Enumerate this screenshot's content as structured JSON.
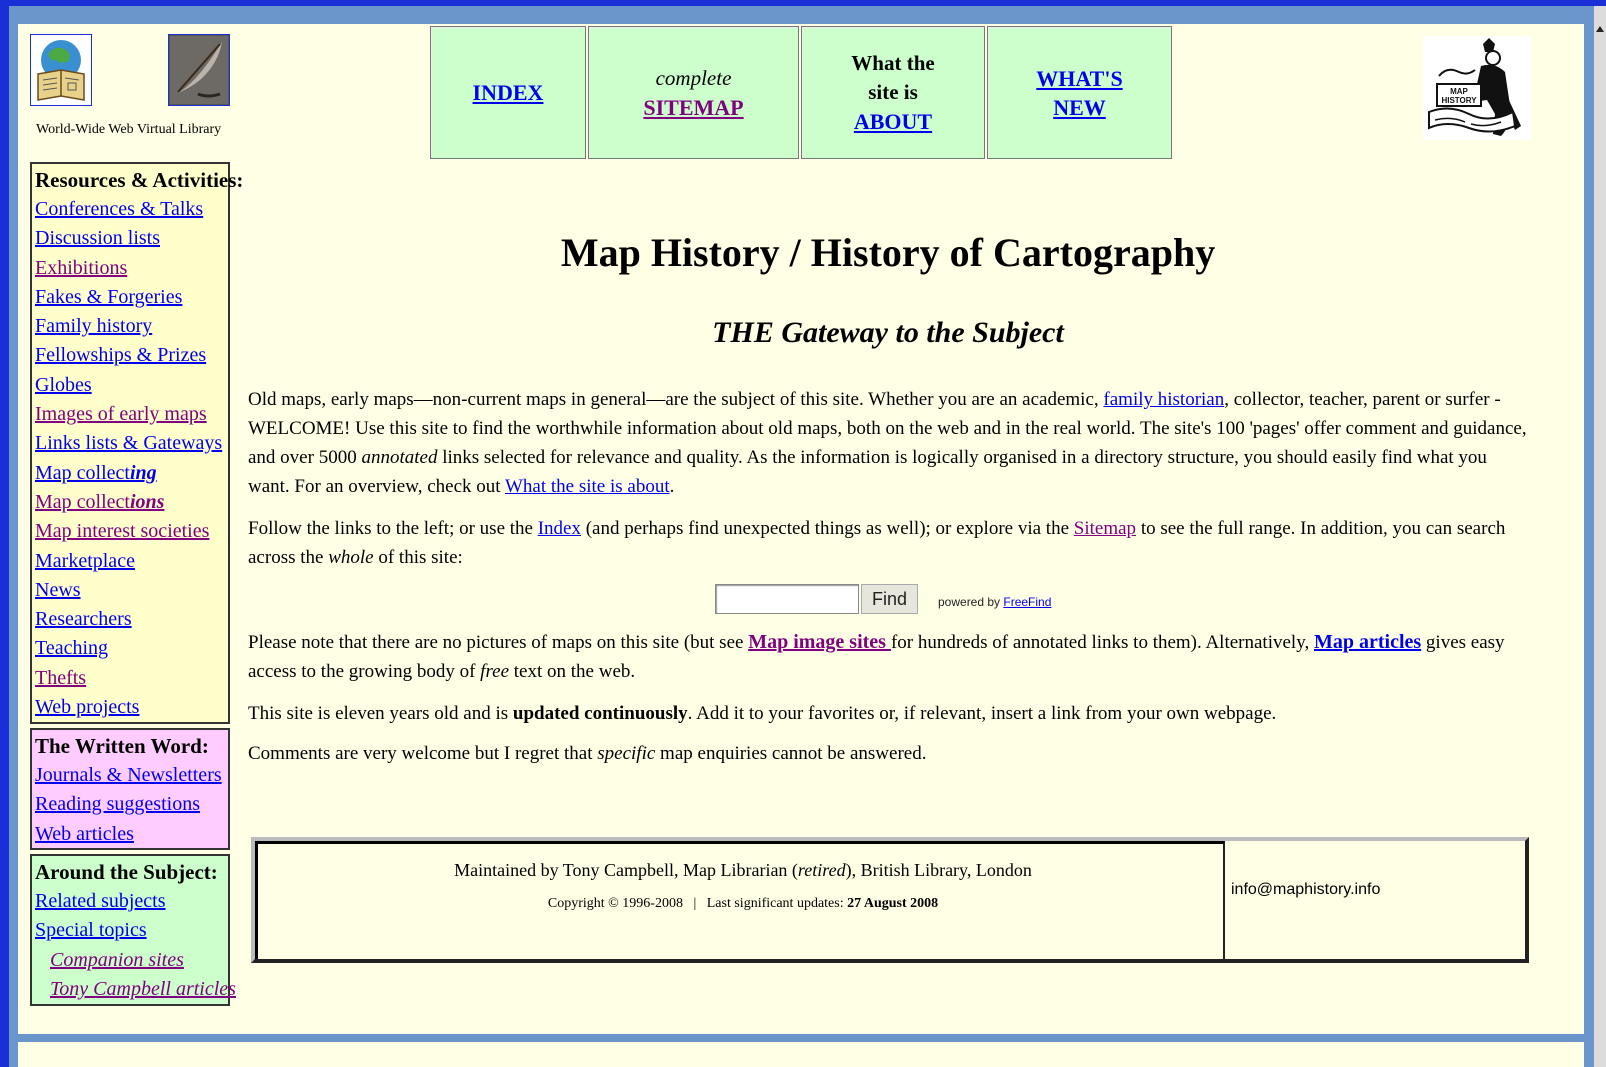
{
  "header": {
    "vl_caption": "World-Wide Web Virtual Library",
    "nav": {
      "index": "INDEX",
      "sitemap_pre": "complete",
      "sitemap": "SITEMAP",
      "about_pre1": "What the",
      "about_pre2": "site is",
      "about": "ABOUT",
      "new1": "WHAT'S",
      "new2": "NEW"
    },
    "mh_logo_text": "MAP HISTORY"
  },
  "sidebar": {
    "resources": {
      "heading": "Resources & Activities:",
      "items": [
        {
          "label": "Conferences & Talks"
        },
        {
          "label": "Discussion lists"
        },
        {
          "label": "Exhibitions"
        },
        {
          "label": "Fakes & Forgeries"
        },
        {
          "label": "Family history"
        },
        {
          "label": "Fellowships & Prizes"
        },
        {
          "label": "Globes"
        },
        {
          "label": "Images of early maps"
        },
        {
          "label": "Links lists & Gateways"
        },
        {
          "label_pre": "Map collect",
          "label_em": "ing"
        },
        {
          "label_pre": "Map collect",
          "label_em": "ions"
        },
        {
          "label": "Map interest societies"
        },
        {
          "label": "Marketplace"
        },
        {
          "label": "News"
        },
        {
          "label": "Researchers"
        },
        {
          "label": "Teaching"
        },
        {
          "label": "Thefts"
        },
        {
          "label": "Web projects"
        }
      ]
    },
    "written": {
      "heading": "The Written Word:",
      "items": [
        {
          "label": "Journals & Newsletters"
        },
        {
          "label": "Reading suggestions"
        },
        {
          "label": "Web articles"
        }
      ]
    },
    "around": {
      "heading": "Around the Subject:",
      "items": [
        {
          "label": "Related subjects"
        },
        {
          "label": "Special topics"
        },
        {
          "label": "Companion sites"
        },
        {
          "label": "Tony Campbell articles"
        }
      ]
    }
  },
  "main": {
    "title": "Map History / History of Cartography",
    "subtitle": "THE Gateway to the Subject",
    "p1": {
      "t1": "Old maps, early maps—non-current maps in general—are the subject of this site. Whether you are an academic, ",
      "link1": "family historian",
      "t2": ", collector, teacher, parent or surfer - WELCOME! Use this site to find the worthwhile information about old maps, both on the web and in the real world. The site's 100 'pages' offer comment and guidance, and over 5000 ",
      "em1": "annotated",
      "t3": " links selected for relevance and quality. As the information is logically organised in a directory structure, you should easily find what you want. For an overview, check out ",
      "link2": "What the site is about",
      "t4": "."
    },
    "p2": {
      "t1": "Follow the links to the left; or use the ",
      "link1": "Index",
      "t2": " (and perhaps find unexpected things as well); or explore via the ",
      "link2": "Sitemap",
      "t3": " to see the full range. In addition, you can search across the ",
      "em1": "whole",
      "t4": " of this site:"
    },
    "search": {
      "value": "",
      "button": "Find",
      "powered_pre": "powered by ",
      "powered_link": "FreeFind"
    },
    "p3": {
      "t1": "Please note that there are no pictures of maps on this site (but see ",
      "link1": "Map image sites ",
      "t2": "for hundreds of annotated links to them). Alternatively, ",
      "link2": "Map articles",
      "t3": " gives easy access to the growing body of ",
      "em1": "free",
      "t4": " text on the web."
    },
    "p4": {
      "t1": "This site is eleven years old and is ",
      "strong1": "updated continuously",
      "t2": ". Add it to your favorites or, if relevant, insert a link from your own webpage."
    },
    "p5": {
      "t1": "Comments are very welcome but I regret that ",
      "em1": "specific",
      "t2": " map enquiries cannot be answered."
    }
  },
  "footer": {
    "maint_pre": "Maintained by Tony Campbell, Map Librarian (",
    "maint_em": "retired",
    "maint_post": "), British Library, London",
    "copy": "Copyright © 1996-2008",
    "sep": "|",
    "updates_label": "Last significant updates: ",
    "updates_date": "27 August 2008",
    "email": "info@maphistory.info"
  },
  "colors": {
    "frame": "#6a96cc",
    "page_bg": "#ffffe6",
    "nav_bg": "#ccffcc",
    "resources_bg": "#ffffcc",
    "written_bg": "#ffccff",
    "around_bg": "#ccffcc",
    "link": "#0000ee",
    "visited": "#800080"
  }
}
